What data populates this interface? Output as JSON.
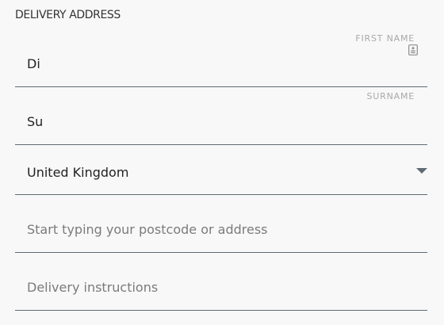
{
  "section": {
    "title": "DELIVERY ADDRESS"
  },
  "fields": {
    "first_name": {
      "label": "FIRST NAME",
      "value": "Di",
      "icon": "contact-card-icon"
    },
    "surname": {
      "label": "SURNAME",
      "value": "Su"
    },
    "country": {
      "value": "United Kingdom",
      "icon": "chevron-down-icon"
    },
    "address": {
      "placeholder": "Start typing your postcode or address"
    },
    "delivery_instructions": {
      "placeholder": "Delivery instructions"
    }
  },
  "colors": {
    "background": "#f8f8f8",
    "underline": "#5e6b73",
    "label": "#a9a9a9",
    "placeholder": "#7b7b7b"
  }
}
